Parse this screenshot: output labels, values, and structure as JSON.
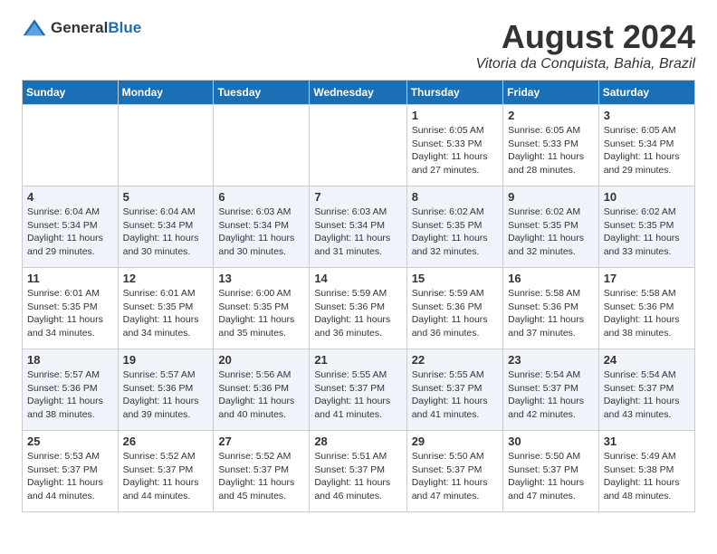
{
  "logo": {
    "text_general": "General",
    "text_blue": "Blue"
  },
  "title": {
    "month_year": "August 2024",
    "location": "Vitoria da Conquista, Bahia, Brazil"
  },
  "days_of_week": [
    "Sunday",
    "Monday",
    "Tuesday",
    "Wednesday",
    "Thursday",
    "Friday",
    "Saturday"
  ],
  "weeks": [
    [
      {
        "day": "",
        "info": ""
      },
      {
        "day": "",
        "info": ""
      },
      {
        "day": "",
        "info": ""
      },
      {
        "day": "",
        "info": ""
      },
      {
        "day": "1",
        "info": "Sunrise: 6:05 AM\nSunset: 5:33 PM\nDaylight: 11 hours and 27 minutes."
      },
      {
        "day": "2",
        "info": "Sunrise: 6:05 AM\nSunset: 5:33 PM\nDaylight: 11 hours and 28 minutes."
      },
      {
        "day": "3",
        "info": "Sunrise: 6:05 AM\nSunset: 5:34 PM\nDaylight: 11 hours and 29 minutes."
      }
    ],
    [
      {
        "day": "4",
        "info": "Sunrise: 6:04 AM\nSunset: 5:34 PM\nDaylight: 11 hours and 29 minutes."
      },
      {
        "day": "5",
        "info": "Sunrise: 6:04 AM\nSunset: 5:34 PM\nDaylight: 11 hours and 30 minutes."
      },
      {
        "day": "6",
        "info": "Sunrise: 6:03 AM\nSunset: 5:34 PM\nDaylight: 11 hours and 30 minutes."
      },
      {
        "day": "7",
        "info": "Sunrise: 6:03 AM\nSunset: 5:34 PM\nDaylight: 11 hours and 31 minutes."
      },
      {
        "day": "8",
        "info": "Sunrise: 6:02 AM\nSunset: 5:35 PM\nDaylight: 11 hours and 32 minutes."
      },
      {
        "day": "9",
        "info": "Sunrise: 6:02 AM\nSunset: 5:35 PM\nDaylight: 11 hours and 32 minutes."
      },
      {
        "day": "10",
        "info": "Sunrise: 6:02 AM\nSunset: 5:35 PM\nDaylight: 11 hours and 33 minutes."
      }
    ],
    [
      {
        "day": "11",
        "info": "Sunrise: 6:01 AM\nSunset: 5:35 PM\nDaylight: 11 hours and 34 minutes."
      },
      {
        "day": "12",
        "info": "Sunrise: 6:01 AM\nSunset: 5:35 PM\nDaylight: 11 hours and 34 minutes."
      },
      {
        "day": "13",
        "info": "Sunrise: 6:00 AM\nSunset: 5:35 PM\nDaylight: 11 hours and 35 minutes."
      },
      {
        "day": "14",
        "info": "Sunrise: 5:59 AM\nSunset: 5:36 PM\nDaylight: 11 hours and 36 minutes."
      },
      {
        "day": "15",
        "info": "Sunrise: 5:59 AM\nSunset: 5:36 PM\nDaylight: 11 hours and 36 minutes."
      },
      {
        "day": "16",
        "info": "Sunrise: 5:58 AM\nSunset: 5:36 PM\nDaylight: 11 hours and 37 minutes."
      },
      {
        "day": "17",
        "info": "Sunrise: 5:58 AM\nSunset: 5:36 PM\nDaylight: 11 hours and 38 minutes."
      }
    ],
    [
      {
        "day": "18",
        "info": "Sunrise: 5:57 AM\nSunset: 5:36 PM\nDaylight: 11 hours and 38 minutes."
      },
      {
        "day": "19",
        "info": "Sunrise: 5:57 AM\nSunset: 5:36 PM\nDaylight: 11 hours and 39 minutes."
      },
      {
        "day": "20",
        "info": "Sunrise: 5:56 AM\nSunset: 5:36 PM\nDaylight: 11 hours and 40 minutes."
      },
      {
        "day": "21",
        "info": "Sunrise: 5:55 AM\nSunset: 5:37 PM\nDaylight: 11 hours and 41 minutes."
      },
      {
        "day": "22",
        "info": "Sunrise: 5:55 AM\nSunset: 5:37 PM\nDaylight: 11 hours and 41 minutes."
      },
      {
        "day": "23",
        "info": "Sunrise: 5:54 AM\nSunset: 5:37 PM\nDaylight: 11 hours and 42 minutes."
      },
      {
        "day": "24",
        "info": "Sunrise: 5:54 AM\nSunset: 5:37 PM\nDaylight: 11 hours and 43 minutes."
      }
    ],
    [
      {
        "day": "25",
        "info": "Sunrise: 5:53 AM\nSunset: 5:37 PM\nDaylight: 11 hours and 44 minutes."
      },
      {
        "day": "26",
        "info": "Sunrise: 5:52 AM\nSunset: 5:37 PM\nDaylight: 11 hours and 44 minutes."
      },
      {
        "day": "27",
        "info": "Sunrise: 5:52 AM\nSunset: 5:37 PM\nDaylight: 11 hours and 45 minutes."
      },
      {
        "day": "28",
        "info": "Sunrise: 5:51 AM\nSunset: 5:37 PM\nDaylight: 11 hours and 46 minutes."
      },
      {
        "day": "29",
        "info": "Sunrise: 5:50 AM\nSunset: 5:37 PM\nDaylight: 11 hours and 47 minutes."
      },
      {
        "day": "30",
        "info": "Sunrise: 5:50 AM\nSunset: 5:37 PM\nDaylight: 11 hours and 47 minutes."
      },
      {
        "day": "31",
        "info": "Sunrise: 5:49 AM\nSunset: 5:38 PM\nDaylight: 11 hours and 48 minutes."
      }
    ]
  ]
}
